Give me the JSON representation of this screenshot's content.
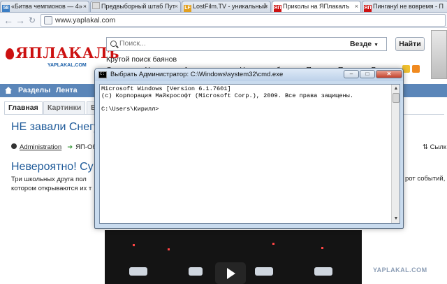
{
  "browser": {
    "tabs": [
      {
        "label": "«Битва чемпионов — 4» -",
        "icon_color": "#3c7ec4",
        "icon_text": "58",
        "active": false
      },
      {
        "label": "Предвыборный штаб Пут",
        "icon_color": "#dddddd",
        "icon_text": "",
        "active": false
      },
      {
        "label": "LostFilm.TV - уникальный",
        "icon_color": "#e2a020",
        "icon_text": "LF",
        "active": false
      },
      {
        "label": "Приколы на ЯПлакалъ",
        "icon_color": "#cc1111",
        "icon_text": "ЯП",
        "active": true
      },
      {
        "label": "Пингануl не вовремя - П",
        "icon_color": "#cc1111",
        "icon_text": "ЯП",
        "active": false
      }
    ],
    "close_glyph": "×",
    "address": "www.yaplakal.com",
    "back_icon": "arrow-left",
    "forward_icon": "arrow-right",
    "reload_icon": "refresh"
  },
  "site": {
    "logo_main": "ЯПЛАКАЛъ",
    "logo_sub": "YAPLAKAL.COM",
    "search": {
      "placeholder": "Поиск...",
      "scope": "Везде",
      "button": "Найти"
    },
    "tagline": "Крутой поиск баянов",
    "top_links": [
      "О портале",
      "Участники",
      "Активные темы",
      "Новые сообщения",
      "Помощь",
      "Правила",
      "Реклама"
    ],
    "nav": {
      "sections": "Разделы",
      "feed": "Лента"
    },
    "subtabs": [
      "Главная",
      "Картинки",
      "В"
    ],
    "post1": {
      "title": "НЕ завали Снегу",
      "author": "Administration",
      "category": "ЯП-Об",
      "right_link": "Сылк"
    },
    "post2": {
      "title": "Невероятно! Су",
      "line1": "Три школьных друга пол",
      "line2": "котором открываются их т",
      "right_text": "рот событий,"
    },
    "watermark": "YAPLAKAL.COM"
  },
  "cmd": {
    "title": "Выбрать Администратор: C:\\Windows\\system32\\cmd.exe",
    "lines": [
      "Microsoft Windows [Version 6.1.7601]",
      "(c) Корпорация Майкрософт (Microsoft Corp.), 2009. Все права защищены.",
      "",
      "C:\\Users\\Кирилл>"
    ],
    "buttons": {
      "minimize": "–",
      "maximize": "□",
      "close": "✕"
    }
  }
}
